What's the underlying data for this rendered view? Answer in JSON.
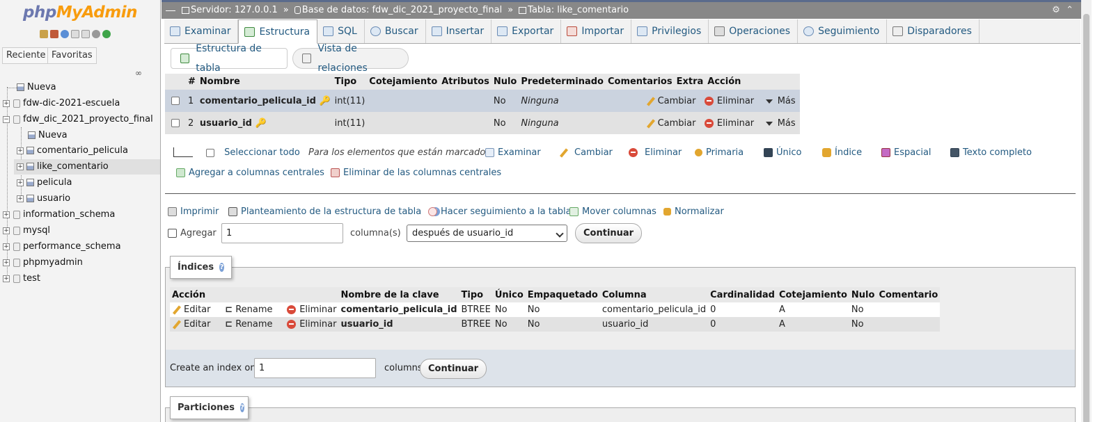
{
  "left": {
    "logo_php": "php",
    "logo_my": "MyAdmin",
    "recent_label": "Reciente",
    "favorites_label": "Favoritas",
    "tree": [
      {
        "label": "Nueva"
      },
      {
        "label": "fdw-dic-2021-escuela"
      },
      {
        "label": "fdw_dic_2021_proyecto_final"
      },
      {
        "label": "Nueva"
      },
      {
        "label": "comentario_pelicula"
      },
      {
        "label": "like_comentario"
      },
      {
        "label": "pelicula"
      },
      {
        "label": "usuario"
      },
      {
        "label": "information_schema"
      },
      {
        "label": "mysql"
      },
      {
        "label": "performance_schema"
      },
      {
        "label": "phpmyadmin"
      },
      {
        "label": "test"
      }
    ]
  },
  "breadcrumb": {
    "server": "Servidor: 127.0.0.1",
    "database": "Base de datos: fdw_dic_2021_proyecto_final",
    "table": "Tabla: like_comentario",
    "sep": "»"
  },
  "tabs": [
    {
      "label": "Examinar"
    },
    {
      "label": "Estructura"
    },
    {
      "label": "SQL"
    },
    {
      "label": "Buscar"
    },
    {
      "label": "Insertar"
    },
    {
      "label": "Exportar"
    },
    {
      "label": "Importar"
    },
    {
      "label": "Privilegios"
    },
    {
      "label": "Operaciones"
    },
    {
      "label": "Seguimiento"
    },
    {
      "label": "Disparadores"
    }
  ],
  "subtabs": {
    "structure": "Estructura de tabla",
    "relations": "Vista de relaciones"
  },
  "structure": {
    "headers": [
      "#",
      "Nombre",
      "Tipo",
      "Cotejamiento",
      "Atributos",
      "Nulo",
      "Predeterminado",
      "Comentarios",
      "Extra",
      "Acción"
    ],
    "rows": [
      {
        "num": "1",
        "name": "comentario_pelicula_id",
        "type": "int(11)",
        "null": "No",
        "default": "Ninguna"
      },
      {
        "num": "2",
        "name": "usuario_id",
        "type": "int(11)",
        "null": "No",
        "default": "Ninguna"
      }
    ],
    "action_change": "Cambiar",
    "action_drop": "Eliminar",
    "action_more": "Más"
  },
  "bulk": {
    "select_all": "Seleccionar todo",
    "for_selected": "Para los elementos que están marcados:",
    "browse": "Examinar",
    "change": "Cambiar",
    "drop": "Eliminar",
    "primary": "Primaria",
    "unique": "Único",
    "index": "Índice",
    "spatial": "Espacial",
    "fulltext": "Texto completo",
    "add_central": "Agregar a columnas centrales",
    "remove_central": "Eliminar de las columnas centrales"
  },
  "tools": {
    "print": "Imprimir",
    "propose": "Planteamiento de la estructura de tabla",
    "track": "Hacer seguimiento a la tabla",
    "move": "Mover columnas",
    "normalize": "Normalizar"
  },
  "add_columns": {
    "label": "Agregar",
    "value": "1",
    "unit": "columna(s)",
    "position": "después de usuario_id",
    "button": "Continuar"
  },
  "indexes": {
    "legend": "Índices",
    "headers": [
      "Acción",
      "Nombre de la clave",
      "Tipo",
      "Único",
      "Empaquetado",
      "Columna",
      "Cardinalidad",
      "Cotejamiento",
      "Nulo",
      "Comentario"
    ],
    "edit": "Editar",
    "rename": "Rename",
    "drop": "Eliminar",
    "rows": [
      {
        "key": "comentario_pelicula_id",
        "type": "BTREE",
        "unique": "No",
        "packed": "No",
        "column": "comentario_pelicula_id",
        "cardinality": "0",
        "collation": "A",
        "null": "No"
      },
      {
        "key": "usuario_id",
        "type": "BTREE",
        "unique": "No",
        "packed": "No",
        "column": "usuario_id",
        "cardinality": "0",
        "collation": "A",
        "null": "No"
      }
    ],
    "create_label": "Create an index on",
    "create_value": "1",
    "create_unit": "columns",
    "create_button": "Continuar"
  },
  "partitions": {
    "legend": "Particiones"
  }
}
